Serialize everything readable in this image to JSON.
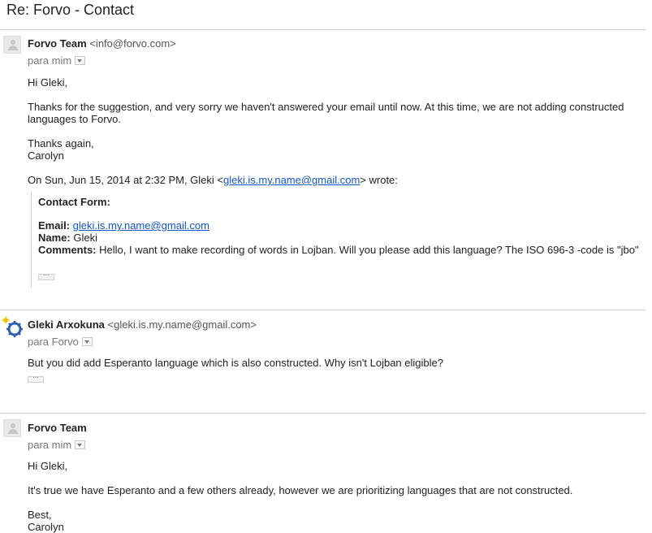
{
  "subject": "Re: Forvo - Contact",
  "messages": [
    {
      "sender_name": "Forvo Team",
      "sender_email": "<info@forvo.com>",
      "to_label": "para mim",
      "greeting": "Hi Gleki,",
      "body_line1": "Thanks for the suggestion, and very sorry we haven't answered your email until now. At this time, we are not adding constructed",
      "body_line2": "languages to Forvo.",
      "signoff1": "Thanks again,",
      "signoff2": "Carolyn",
      "quote_header_prefix": "On Sun, Jun 15, 2014 at 2:32 PM, Gleki <",
      "quote_header_email": "gleki.is.my.name@gmail.com",
      "quote_header_suffix": "> wrote:",
      "quote": {
        "title": "Contact Form:",
        "email_label": "Email:",
        "email_value": "gleki.is.my.name@gmail.com",
        "name_label": "Name:",
        "name_value": "Gleki",
        "comments_label": "Comments:",
        "comments_value": "Hello, I want to make recording of words in Lojban. Will you please add this language? The ISO 696-3 -code is \"jbo\""
      }
    },
    {
      "sender_name": "Gleki Arxokuna",
      "sender_email": "<gleki.is.my.name@gmail.com>",
      "to_label": "para Forvo",
      "body": "But you did add Esperanto language which is also constructed. Why isn't Lojban eligible?"
    },
    {
      "sender_name": "Forvo Team",
      "to_label": "para mim",
      "greeting": "Hi Gleki,",
      "body": "It's true we have Esperanto and a few others already, however we are prioritizing languages that are not constructed.",
      "signoff1": "Best,",
      "signoff2": "Carolyn"
    }
  ]
}
